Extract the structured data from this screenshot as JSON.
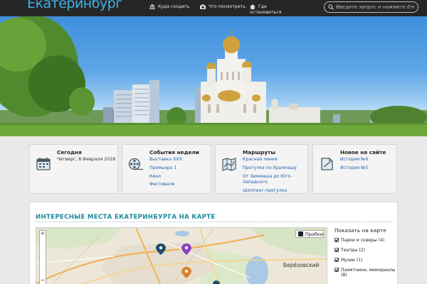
{
  "site": {
    "logo": "Екатеринбург"
  },
  "nav": [
    {
      "label": "Куда сходить",
      "icon": "building-icon"
    },
    {
      "label": "Что посмотреть",
      "icon": "camera-icon"
    },
    {
      "label": "Где",
      "label2": "остановиться",
      "icon": "house-icon"
    }
  ],
  "search": {
    "placeholder": "Введите запрос и нажмите Enter"
  },
  "cards": [
    {
      "title": "Сегодня",
      "icon": "calendar-icon",
      "items": [
        "Четверг, 8 Февраля 2018"
      ]
    },
    {
      "title": "События недели",
      "icon": "film-reel-icon",
      "items": [
        "Выставка XXX",
        "Премьера 1",
        "Кино",
        "Фестивали"
      ]
    },
    {
      "title": "Маршруты",
      "icon": "map-icon",
      "items": [
        "Красная линия",
        "Прогулка по Уралмашу",
        "От Химмаша до Юго-",
        "Западного",
        "Шоппинг-прогулка"
      ]
    },
    {
      "title": "Новое на сайте",
      "icon": "document-icon",
      "items": [
        "История №6",
        "История №5"
      ]
    }
  ],
  "map_section": {
    "heading": "ИНТЕРЕСНЫЕ МЕСТА ЕКАТЕРИНБУРГА НА КАРТЕ",
    "traffic_button": "Пробки",
    "city_label": "Берёзовский",
    "zoom_in": "+",
    "zoom_out": "−",
    "legend_title": "Показать на карте",
    "legend": [
      "Парки и скверы (4)",
      "Театры (2)",
      "Музеи (1)",
      "Памятники, мемориалы (8)"
    ]
  },
  "colors": {
    "topbar": "#262626",
    "logo": "#3fb0e8",
    "link": "#1e5fa8",
    "heading": "#1f8a9c",
    "pin_blue": "#1d4a70",
    "pin_purple": "#8e3fbf",
    "pin_orange": "#d9822b"
  }
}
